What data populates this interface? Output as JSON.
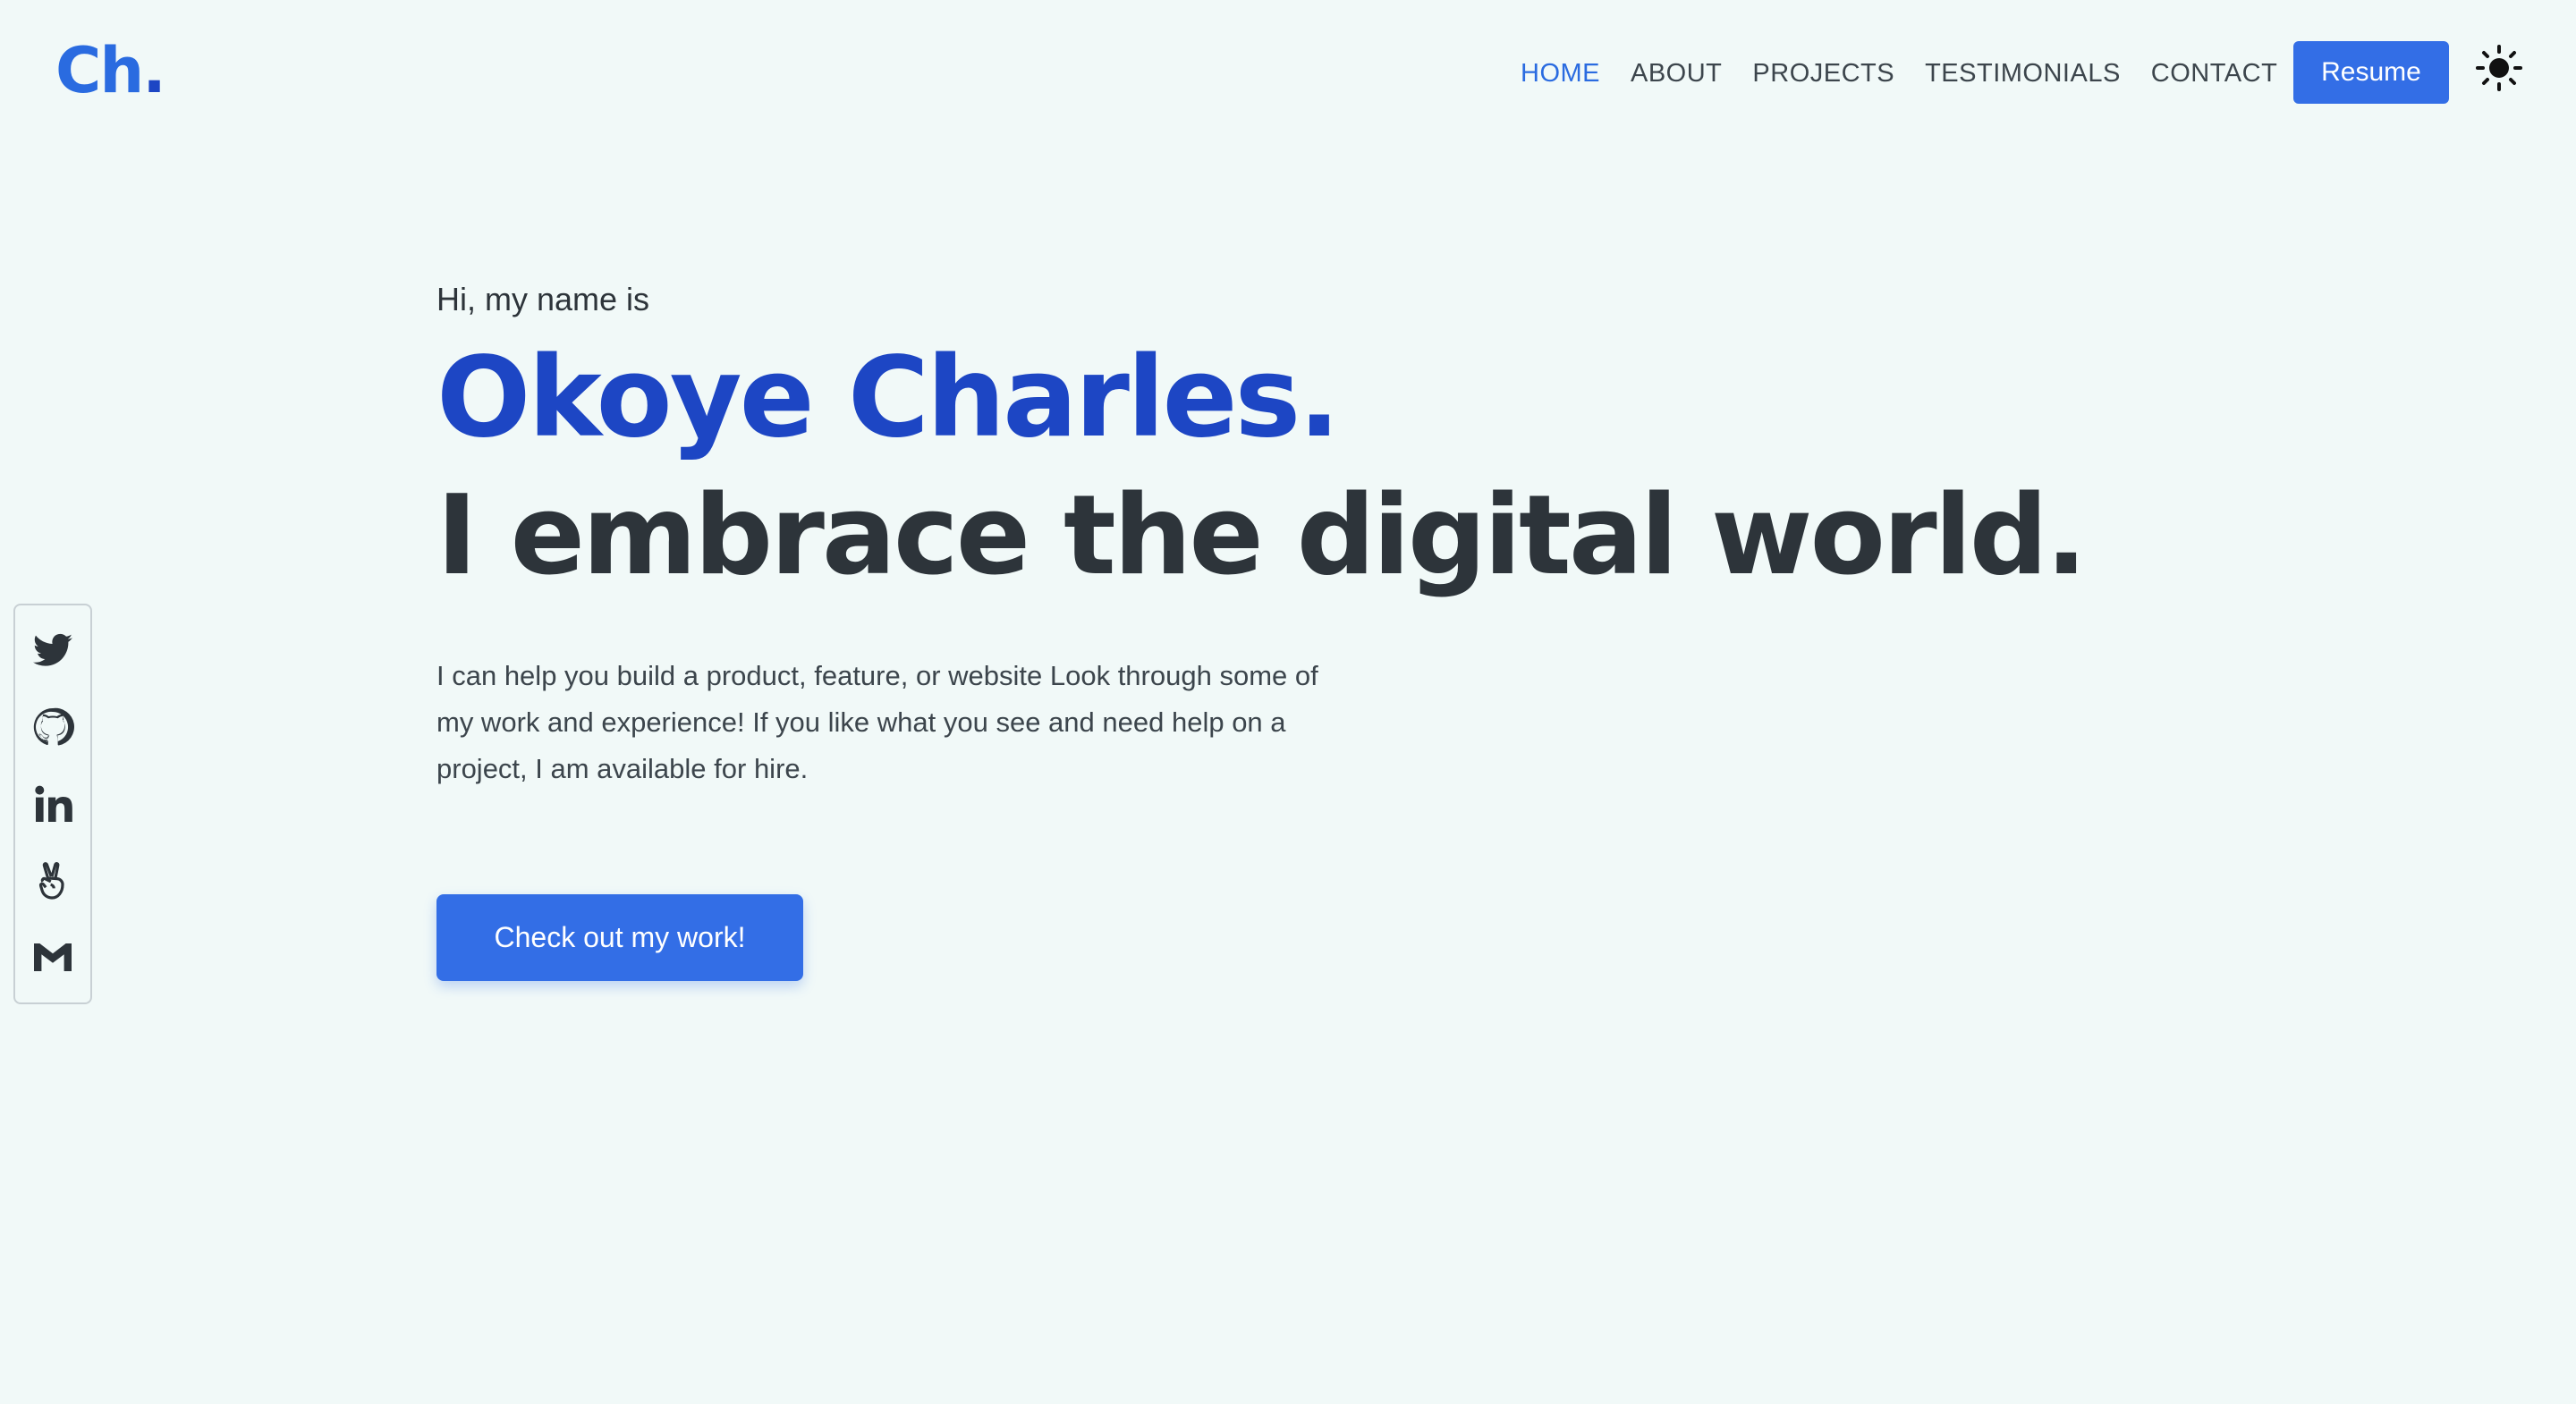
{
  "header": {
    "logo_main": "Ch",
    "logo_dot": ".",
    "nav": [
      {
        "label": "HOME",
        "active": true
      },
      {
        "label": "ABOUT",
        "active": false
      },
      {
        "label": "PROJECTS",
        "active": false
      },
      {
        "label": "TESTIMONIALS",
        "active": false
      },
      {
        "label": "CONTACT",
        "active": false
      }
    ],
    "resume_label": "Resume",
    "theme_icon": "sun-icon"
  },
  "social": [
    {
      "icon": "twitter-icon"
    },
    {
      "icon": "github-icon"
    },
    {
      "icon": "linkedin-icon"
    },
    {
      "icon": "angellist-icon"
    },
    {
      "icon": "gmail-icon"
    }
  ],
  "hero": {
    "greeting": "Hi, my name is",
    "name": "Okoye Charles.",
    "tagline": "I embrace the digital world.",
    "intro": "I can help you build a product, feature, or website Look through some of my work and experience! If you like what you see and need help on a project, I am available for hire.",
    "cta_label": "Check out my work!"
  },
  "colors": {
    "background": "#f1f9f8",
    "accent": "#336ee6",
    "name": "#1d46c4",
    "text_dark": "#2d343a"
  }
}
